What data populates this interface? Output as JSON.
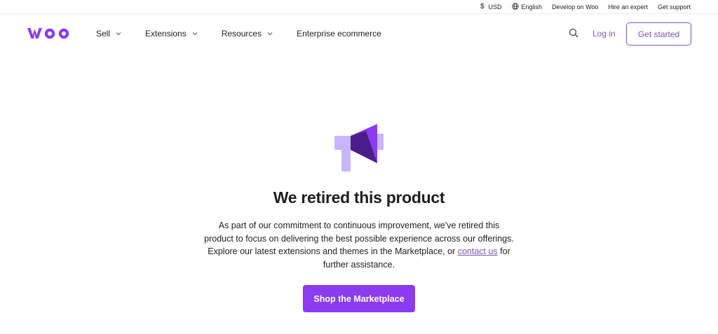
{
  "topbar": {
    "currency_symbol": "$",
    "currency_label": "USD",
    "language_label": "English",
    "develop_label": "Develop on Woo",
    "hire_label": "Hire an expert",
    "support_label": "Get support"
  },
  "nav": {
    "logo_text": "woo",
    "items": [
      {
        "label": "Sell",
        "has_dropdown": true
      },
      {
        "label": "Extensions",
        "has_dropdown": true
      },
      {
        "label": "Resources",
        "has_dropdown": true
      },
      {
        "label": "Enterprise ecommerce",
        "has_dropdown": false
      }
    ],
    "login_label": "Log in",
    "get_started_label": "Get started"
  },
  "main": {
    "icon": "megaphone-icon",
    "headline": "We retired this product",
    "body_lines": [
      "As part of our commitment to continuous improvement, we've retired this",
      "product to focus on delivering the best possible experience across our offerings.",
      "Explore our latest extensions and themes in the Marketplace, or "
    ],
    "contact_link": "contact us",
    "body_after_link": " for",
    "body_last_line": "further assistance.",
    "cta_label": "Shop the Marketplace"
  },
  "colors": {
    "brand_purple": "#7f54b3",
    "cta_purple": "#8c3bf2",
    "icon_light": "#c9b5f9",
    "icon_mid": "#8c3bf2",
    "icon_dark": "#4a1d8a"
  }
}
